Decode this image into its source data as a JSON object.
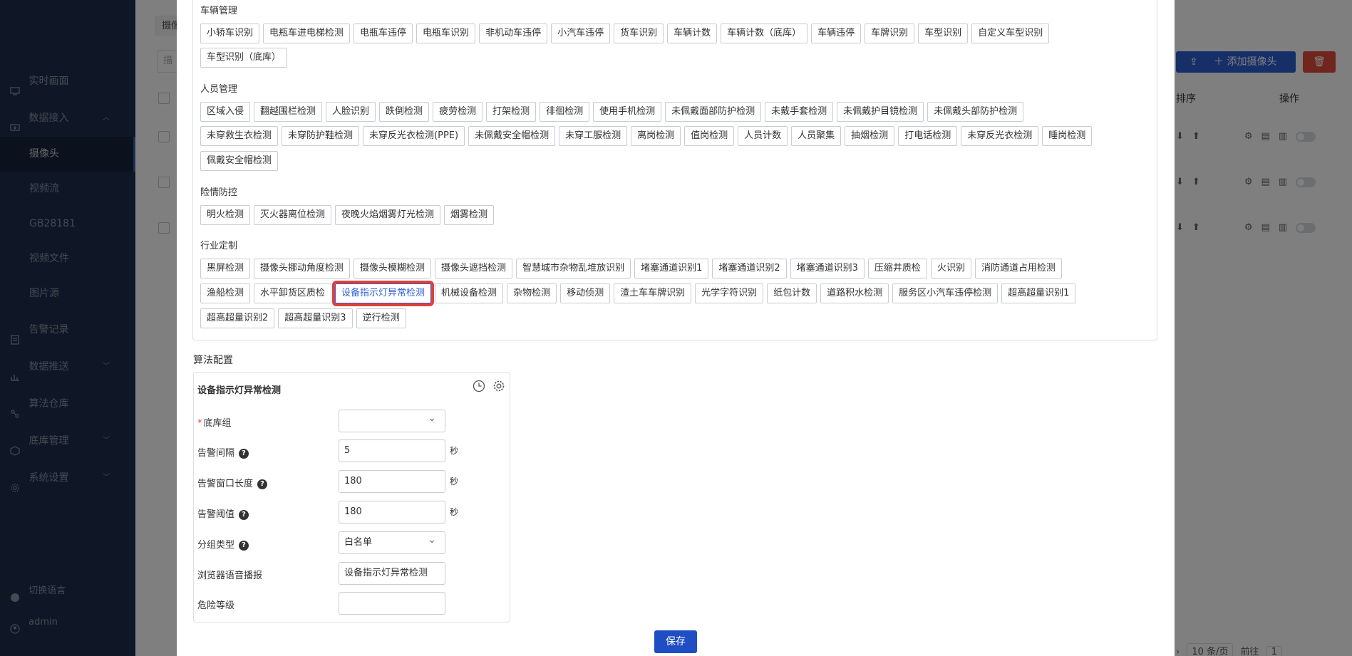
{
  "sidebar": {
    "items": [
      {
        "label": "实时画面",
        "icon": "monitor-icon"
      },
      {
        "label": "数据接入",
        "icon": "data-input-icon",
        "expanded": true
      },
      {
        "label": "摄像头",
        "sub": true,
        "active": true
      },
      {
        "label": "视频流",
        "sub": true
      },
      {
        "label": "GB28181",
        "sub": true
      },
      {
        "label": "视频文件",
        "sub": true
      },
      {
        "label": "图片源",
        "sub": true
      },
      {
        "label": "告警记录",
        "icon": "alarm-record-icon"
      },
      {
        "label": "数据推送",
        "icon": "data-push-icon",
        "expandable": true
      },
      {
        "label": "算法仓库",
        "icon": "algorithm-warehouse-icon"
      },
      {
        "label": "底库管理",
        "icon": "database-icon",
        "expandable": true
      },
      {
        "label": "系统设置",
        "icon": "gear-icon",
        "expandable": true
      }
    ],
    "language_label": "切换语言",
    "user_label": "admin"
  },
  "background": {
    "tab_label": "摄像",
    "search_placeholder": "描",
    "add_camera_label": "添加摄像头",
    "col_sort": "排序",
    "col_op": "操作",
    "page_size": "10 条/页",
    "goto_label": "前往",
    "page_number": "1"
  },
  "categories": {
    "vehicle": {
      "title": "车辆管理",
      "row1": [
        "小轿车识别",
        "电瓶车进电梯检测",
        "电瓶车违停",
        "电瓶车识别",
        "非机动车违停",
        "小汽车违停",
        "货车识别",
        "车辆计数",
        "车辆计数（底库）",
        "车辆违停",
        "车牌识别",
        "车型识别",
        "自定义车型识别"
      ],
      "row2": [
        "车型识别（底库）"
      ]
    },
    "person": {
      "title": "人员管理",
      "row1": [
        "区域入侵",
        "翻越围栏检测",
        "人脸识别",
        "跌倒检测",
        "疲劳检测",
        "打架检测",
        "徘徊检测",
        "使用手机检测",
        "未佩戴面部防护检测",
        "未戴手套检测",
        "未佩戴护目镜检测",
        "未佩戴头部防护检测"
      ],
      "row2": [
        "未穿救生衣检测",
        "未穿防护鞋检测",
        "未穿反光衣检测(PPE)",
        "未佩戴安全帽检测",
        "未穿工服检测",
        "离岗检测",
        "值岗检测",
        "人员计数",
        "人员聚集",
        "抽烟检测",
        "打电话检测",
        "未穿反光衣检测",
        "睡岗检测"
      ],
      "row3": [
        "佩戴安全帽检测"
      ]
    },
    "danger": {
      "title": "险情防控",
      "row1": [
        "明火检测",
        "灭火器离位检测",
        "夜晚火焰烟雾灯光检测",
        "烟雾检测"
      ]
    },
    "industry": {
      "title": "行业定制",
      "row1": [
        "黑屏检测",
        "摄像头挪动角度检测",
        "摄像头模糊检测",
        "摄像头遮挡检测",
        "智慧城市杂物乱堆放识别",
        "堵塞通道识别1",
        "堵塞通道识别2",
        "堵塞通道识别3",
        "压缩井质检",
        "火识别",
        "消防通道占用检测"
      ],
      "row2": [
        "渔船检测",
        "水平卸货区质检",
        "设备指示灯异常检测",
        "机械设备检测",
        "杂物检测",
        "移动侦测",
        "渣土车车牌识别",
        "光学字符识别",
        "纸包计数",
        "道路积水检测",
        "服务区小汽车违停检测",
        "超高超量识别1"
      ],
      "row3": [
        "超高超量识别2",
        "超高超量识别3",
        "逆行检测"
      ],
      "selected": "设备指示灯异常检测"
    }
  },
  "config": {
    "heading": "算法配置",
    "card_title": "设备指示灯异常检测",
    "fields": {
      "base_group": {
        "label": "底库组",
        "value": ""
      },
      "alarm_interval": {
        "label": "告警间隔",
        "value": "5",
        "unit": "秒"
      },
      "alarm_window": {
        "label": "告警窗口长度",
        "value": "180",
        "unit": "秒"
      },
      "alarm_threshold": {
        "label": "告警阈值",
        "value": "180",
        "unit": "秒"
      },
      "group_type": {
        "label": "分组类型",
        "value": "白名单"
      },
      "voice_broadcast": {
        "label": "浏览器语音播报",
        "value": "设备指示灯异常检测"
      },
      "danger_level": {
        "label": "危险等级",
        "value": ""
      }
    },
    "save_label": "保存"
  },
  "colors": {
    "primary": "#2d5fd3",
    "highlight": "#e0403a",
    "sidebar": "#1e2e4e"
  }
}
